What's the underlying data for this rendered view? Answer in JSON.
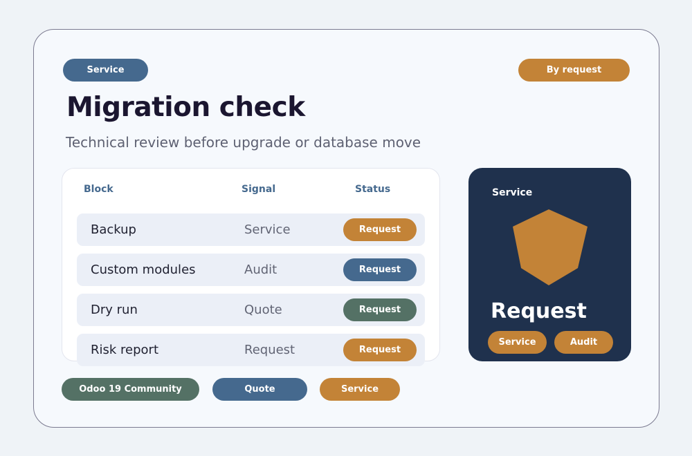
{
  "header": {
    "service_tag": "Service",
    "request_tag": "By request",
    "title": "Migration check",
    "subtitle": "Technical review before upgrade or database move"
  },
  "table": {
    "columns": [
      "Block",
      "Signal",
      "Status"
    ],
    "rows": [
      {
        "block": "Backup",
        "signal": "Service",
        "status": "Request",
        "status_color": "#c38337"
      },
      {
        "block": "Custom modules",
        "signal": "Audit",
        "status": "Request",
        "status_color": "#45698e"
      },
      {
        "block": "Dry run",
        "signal": "Quote",
        "status": "Request",
        "status_color": "#547165"
      },
      {
        "block": "Risk report",
        "signal": "Request",
        "status": "Request",
        "status_color": "#c38337"
      }
    ]
  },
  "side_card": {
    "label": "Service",
    "shape_icon": "pentagon-icon",
    "big_text": "Request",
    "buttons": [
      "Service",
      "Audit"
    ]
  },
  "footer": {
    "tags": [
      "Odoo 19 Community",
      "Quote",
      "Service"
    ]
  },
  "colors": {
    "blue": "#45698e",
    "orange": "#c38337",
    "green": "#547165",
    "navy": "#1f314d"
  }
}
